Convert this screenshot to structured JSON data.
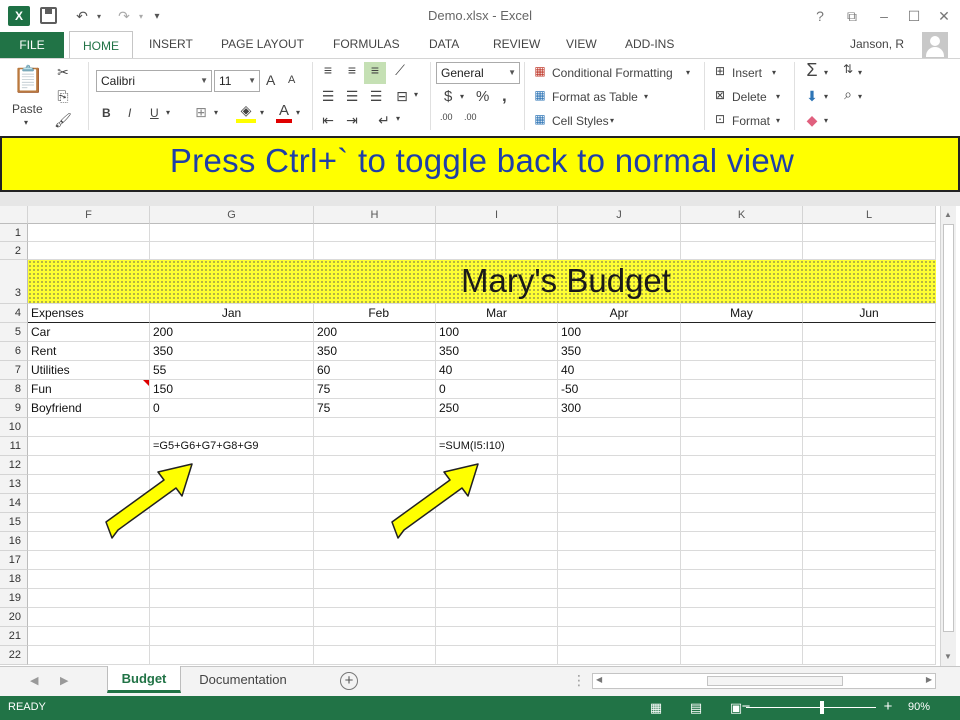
{
  "window": {
    "title": "Demo.xlsx - Excel",
    "logo": "X",
    "help": "?",
    "user": "Janson, R"
  },
  "tabs": [
    "FILE",
    "HOME",
    "INSERT",
    "PAGE LAYOUT",
    "FORMULAS",
    "DATA",
    "REVIEW",
    "VIEW",
    "ADD-INS"
  ],
  "ribbon": {
    "paste_label": "Paste",
    "font_name": "Calibri",
    "font_size": "11",
    "number_format": "General",
    "conditional_formatting": "Conditional Formatting",
    "format_as_table": "Format as Table",
    "cell_styles": "Cell Styles",
    "insert": "Insert",
    "delete": "Delete",
    "format": "Format",
    "bold": "B",
    "italic": "I",
    "underline": "U",
    "dollar": "$",
    "percent": "%",
    "comma": ",",
    "inc_decimal": ".00",
    "dec_decimal": ".00",
    "grow_font": "A",
    "shrink_font": "A",
    "font_color": "A"
  },
  "banner": {
    "text": "Press Ctrl+` to toggle back to normal view"
  },
  "sheet": {
    "columns": [
      "F",
      "G",
      "H",
      "I",
      "J",
      "K",
      "L"
    ],
    "rows": [
      "1",
      "2",
      "3",
      "4",
      "5",
      "6",
      "7",
      "8",
      "9",
      "10",
      "11",
      "12",
      "13",
      "14",
      "15",
      "16",
      "17",
      "18",
      "19",
      "20",
      "21",
      "22"
    ],
    "title": "Mary's Budget",
    "header_row": [
      "Expenses",
      "Jan",
      "Feb",
      "Mar",
      "Apr",
      "May",
      "Jun"
    ],
    "data_rows": [
      [
        "Car",
        "200",
        "200",
        "100",
        "100"
      ],
      [
        "Rent",
        "350",
        "350",
        "350",
        "350"
      ],
      [
        "Utilities",
        "55",
        "60",
        "40",
        "40"
      ],
      [
        "Fun",
        "150",
        "75",
        "0",
        "-50"
      ],
      [
        "Boyfriend",
        "0",
        "75",
        "250",
        "300"
      ]
    ],
    "formula_g11": "=G5+G6+G7+G8+G9",
    "formula_i11": "=SUM(I5:I10)"
  },
  "sheet_tabs": {
    "active": "Budget",
    "other": "Documentation",
    "add": "+"
  },
  "status": {
    "text": "READY",
    "zoom": "90%",
    "zoom_minus": "−",
    "zoom_plus": "+"
  },
  "colors": {
    "excel_green": "#217346",
    "banner_yellow": "#ffff00",
    "banner_text": "#1f3fa8",
    "arrow_fill": "#ffff00"
  }
}
